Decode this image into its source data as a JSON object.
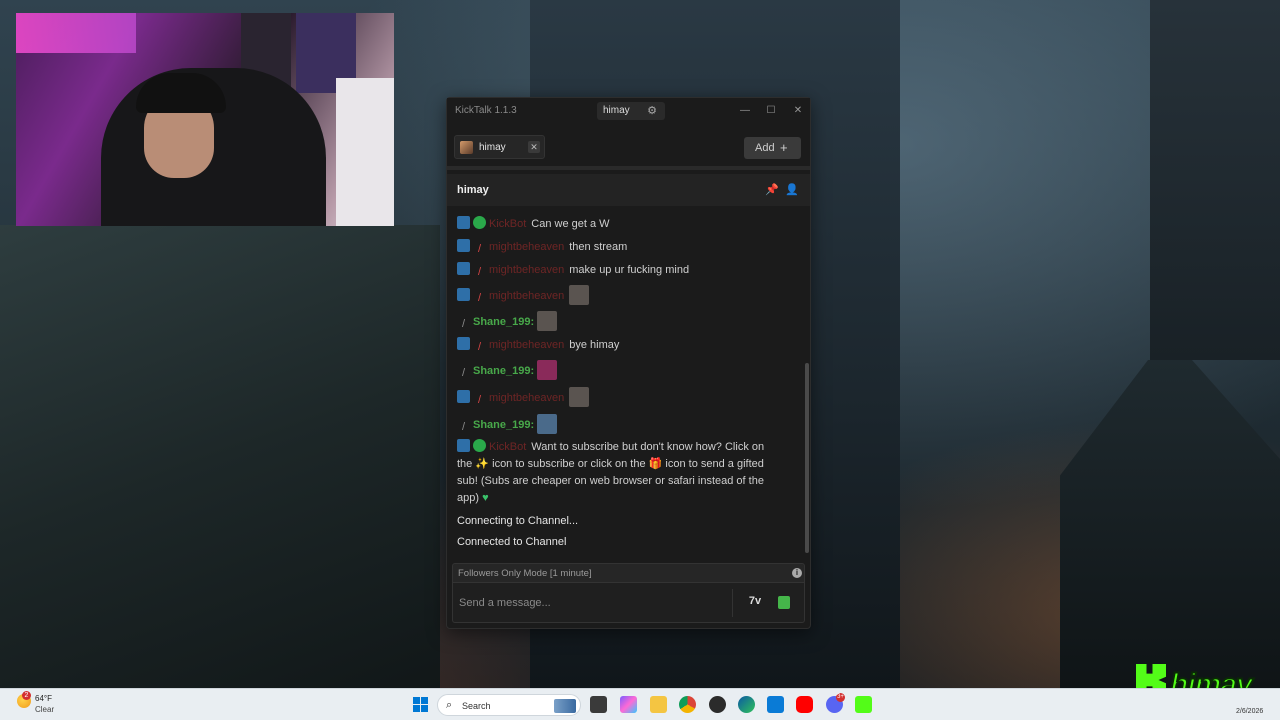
{
  "window": {
    "title": "KickTalk 1.1.3",
    "user_pill": "himay",
    "controls": {
      "minimize": "—",
      "maximize": "☐",
      "close": "✕"
    }
  },
  "tabs": [
    {
      "label": "himay",
      "close": "✕"
    }
  ],
  "add_button": {
    "label": "Add",
    "icon": "+"
  },
  "channel": {
    "name": "himay"
  },
  "messages": [
    {
      "badges": [
        "pin",
        "verified"
      ],
      "username": "KickBot",
      "text": "Can we get a W"
    },
    {
      "badges": [
        "pin",
        "sword"
      ],
      "username": "mightbeheaven",
      "text": "then stream"
    },
    {
      "badges": [
        "pin",
        "sword"
      ],
      "username": "mightbeheaven",
      "text": "make up ur fucking mind"
    },
    {
      "badges": [
        "pin",
        "sword"
      ],
      "username": "mightbeheaven",
      "text": "",
      "emote": true
    },
    {
      "badges": [
        "sword-gray"
      ],
      "username": "Shane_199:",
      "text": "",
      "emote": true
    },
    {
      "badges": [
        "pin",
        "sword"
      ],
      "username": "mightbeheaven",
      "text": "bye himay"
    },
    {
      "badges": [
        "sword-gray"
      ],
      "username": "Shane_199:",
      "text": "",
      "emote": true
    },
    {
      "badges": [
        "pin",
        "sword"
      ],
      "username": "mightbeheaven",
      "text": "",
      "emote": true
    },
    {
      "badges": [
        "sword-gray"
      ],
      "username": "Shane_199:",
      "text": "",
      "emote": true
    },
    {
      "badges": [
        "pin",
        "verified"
      ],
      "username": "KickBot",
      "text_line1": "Want to subscribe but don't know how? Click on",
      "text_line2a": "the",
      "text_line2b": "icon to subscribe or click on the",
      "text_line2c": "icon to send a gifted",
      "text_line3": "sub! (Subs are cheaper on web browser or safari instead of the",
      "text_line4": "app)",
      "heart": "♥"
    }
  ],
  "system_messages": [
    "Connecting to Channel...",
    "Connected to Channel"
  ],
  "followers_mode": "Followers Only Mode [1 minute]",
  "message_input": {
    "placeholder": "Send a message...",
    "value": ""
  },
  "overlay": {
    "brand": "himay"
  },
  "taskbar": {
    "weather_temp": "64°F",
    "weather_condition": "Clear",
    "weather_badge": "2",
    "search_label": "Search",
    "discord_badge": "3+",
    "date": "2/6/2026"
  },
  "colors": {
    "kick_green": "#53fc18",
    "user_green": "#48a84a",
    "user_red": "#6e2525",
    "accent_blue": "#2e6fa8"
  }
}
